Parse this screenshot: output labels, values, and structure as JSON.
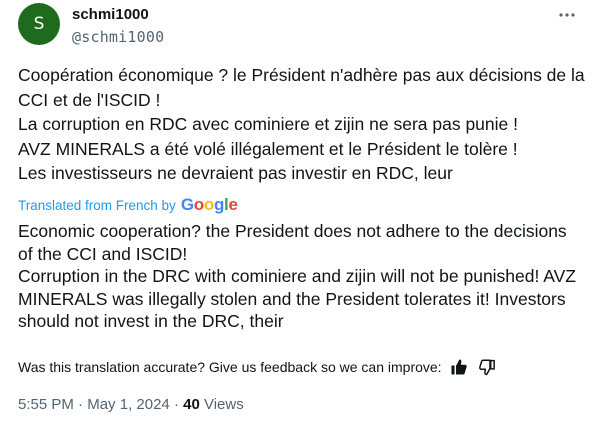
{
  "author": {
    "avatar_letter": "S",
    "avatar_color": "#1e6b1e",
    "name": "schmi1000",
    "handle": "@schmi1000"
  },
  "post": {
    "original_lines": [
      "Coopération économique  ? le Président n'adhère pas aux décisions de la CCI et de l'ISCID !",
      "La corruption en RDC avec cominiere et zijin ne sera pas punie !",
      "AVZ MINERALS a été volé illégalement et le Président le tolère !",
      "Les investisseurs ne devraient pas investir en RDC, leur"
    ],
    "translated_from_label": "Translated from French by",
    "translator_brand": [
      "G",
      "o",
      "o",
      "g",
      "l",
      "e"
    ],
    "translator_brand_colors": [
      "#4285F4",
      "#EA4335",
      "#FBBC05",
      "#4285F4",
      "#34A853",
      "#EA4335"
    ],
    "translation_lines": [
      "Economic cooperation? the President does not adhere to the decisions of the CCI and ISCID!",
      "Corruption in the DRC with cominiere and zijin will not be punished! AVZ MINERALS was illegally stolen and the President tolerates it! Investors should not invest in the DRC, their"
    ]
  },
  "feedback": {
    "question": "Was this translation accurate? Give us feedback so we can improve:",
    "thumbs_up_icon": "thumbs-up-icon",
    "thumbs_down_icon": "thumbs-down-icon"
  },
  "meta": {
    "time": "5:55 PM",
    "separator": " · ",
    "date": "May 1, 2024",
    "views_count": "40",
    "views_label": "Views"
  },
  "colors": {
    "link_blue": "#1d9bf0",
    "secondary_text": "#536471",
    "primary_text": "#0f1419"
  }
}
